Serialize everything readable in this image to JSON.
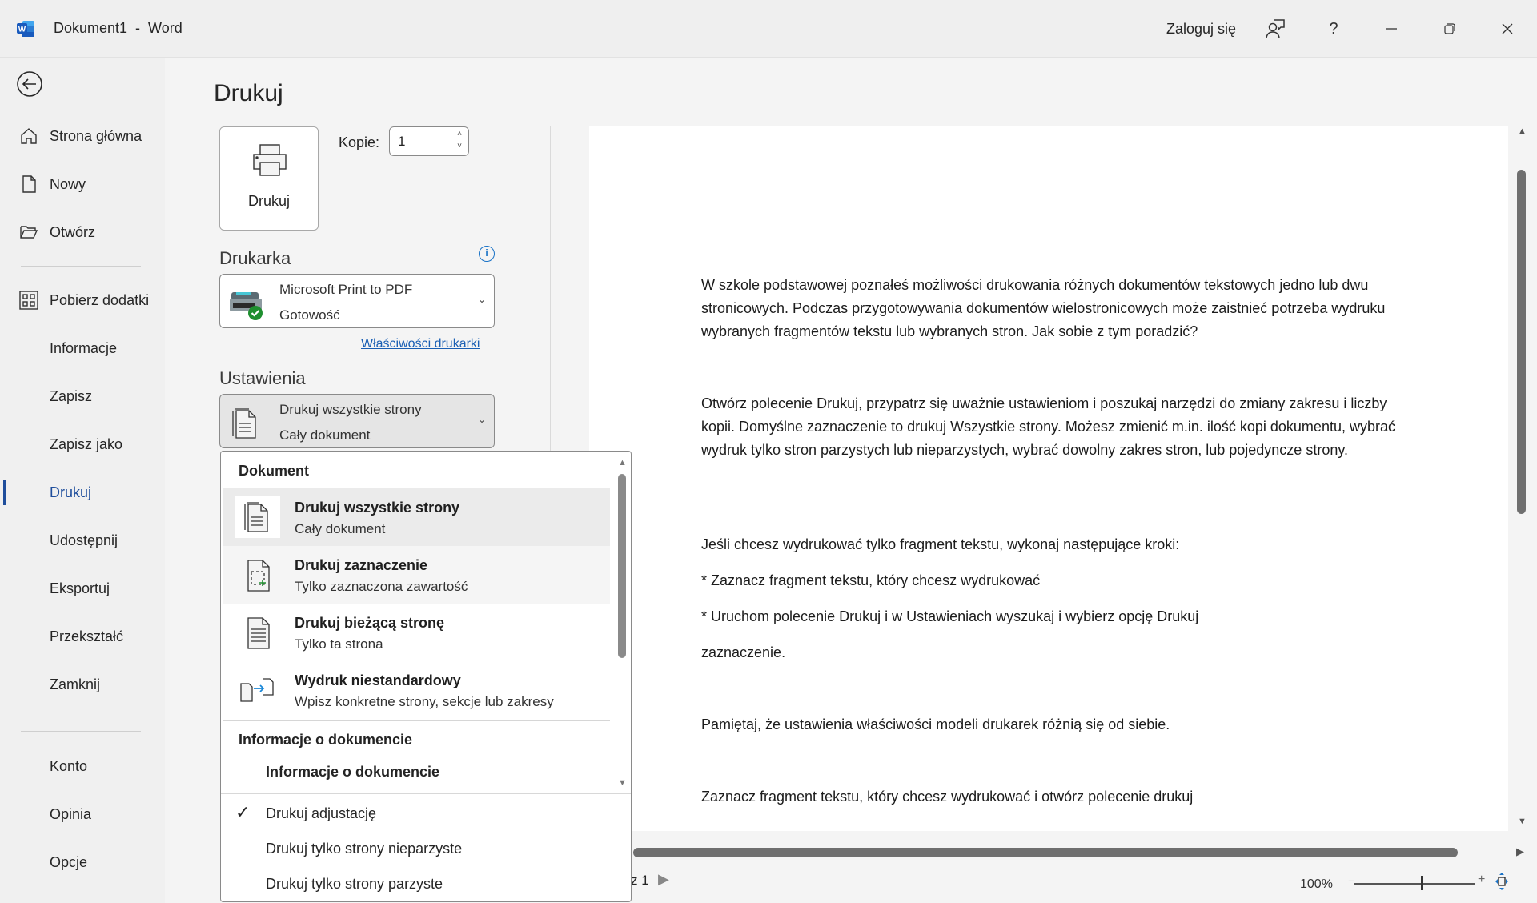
{
  "titlebar": {
    "title": "Dokument1  -  Word",
    "signin": "Zaloguj się",
    "icons": [
      "word-logo-icon",
      "feedback-icon",
      "help-icon",
      "minimize-icon",
      "restore-icon",
      "close-icon"
    ]
  },
  "sidebar": {
    "items": [
      {
        "label": "Strona główna",
        "icon": "home-icon"
      },
      {
        "label": "Nowy",
        "icon": "new-document-icon"
      },
      {
        "label": "Otwórz",
        "icon": "open-folder-icon"
      },
      {
        "label": "Pobierz dodatki",
        "icon": "addins-icon"
      },
      {
        "label": "Informacje"
      },
      {
        "label": "Zapisz"
      },
      {
        "label": "Zapisz jako"
      },
      {
        "label": "Drukuj",
        "active": true
      },
      {
        "label": "Udostępnij"
      },
      {
        "label": "Eksportuj"
      },
      {
        "label": "Przekształć"
      },
      {
        "label": "Zamknij"
      },
      {
        "label": "Konto"
      },
      {
        "label": "Opinia"
      },
      {
        "label": "Opcje"
      }
    ]
  },
  "print": {
    "title": "Drukuj",
    "print_button": "Drukuj",
    "copies_label": "Kopie:",
    "copies_value": "1",
    "printer_heading": "Drukarka",
    "printer_name": "Microsoft Print to PDF",
    "printer_status": "Gotowość",
    "printer_properties": "Właściwości drukarki",
    "settings_heading": "Ustawienia",
    "settings_line1": "Drukuj wszystkie strony",
    "settings_line2": "Cały dokument"
  },
  "menu": {
    "group1": "Dokument",
    "items": [
      {
        "title": "Drukuj wszystkie strony",
        "sub": "Cały dokument"
      },
      {
        "title": "Drukuj zaznaczenie",
        "sub": "Tylko zaznaczona zawartość"
      },
      {
        "title": "Drukuj bieżącą stronę",
        "sub": "Tylko ta strona"
      },
      {
        "title": "Wydruk niestandardowy",
        "sub": "Wpisz konkretne strony, sekcje lub zakresy"
      }
    ],
    "group2": "Informacje o dokumencie",
    "info_item": "Informacje o dokumencie",
    "options": [
      {
        "label": "Drukuj adjustację",
        "checked": true
      },
      {
        "label": "Drukuj tylko strony nieparzyste",
        "checked": false
      },
      {
        "label": "Drukuj tylko strony parzyste",
        "checked": false
      }
    ]
  },
  "preview": {
    "paragraphs": [
      "W szkole podstawowej poznałeś możliwości drukowania różnych dokumentów tekstowych jedno lub dwu stronicowych. Podczas przygotowywania dokumentów wielostronicowych może zaistnieć potrzeba wydruku wybranych fragmentów tekstu lub wybranych stron. Jak sobie z tym poradzić?",
      "Otwórz polecenie Drukuj, przypatrz się uważnie ustawieniom i poszukaj narzędzi do zmiany zakresu i liczby kopii. Domyślne zaznaczenie to drukuj Wszystkie strony. Możesz zmienić m.in. ilość kopi dokumentu, wybrać wydruk tylko stron parzystych lub nieparzystych, wybrać dowolny zakres stron, lub pojedyncze strony.",
      "Jeśli chcesz wydrukować tylko fragment tekstu, wykonaj następujące kroki:",
      "* Zaznacz fragment tekstu, który chcesz wydrukować",
      "* Uruchom polecenie Drukuj i w Ustawieniach wyszukaj i wybierz opcję Drukuj",
      "zaznaczenie.",
      "Pamiętaj, że ustawienia właściwości modeli drukarek różnią się od siebie.",
      "Zaznacz fragment tekstu, który chcesz wydrukować i otwórz polecenie drukuj"
    ]
  },
  "footer": {
    "page_of": "z 1",
    "zoom": "100%",
    "zoom_minus": "−",
    "zoom_plus": "+"
  },
  "colors": {
    "accent": "#1f4e9c",
    "link": "#1a5fb4",
    "word_blue": "#185abd"
  }
}
